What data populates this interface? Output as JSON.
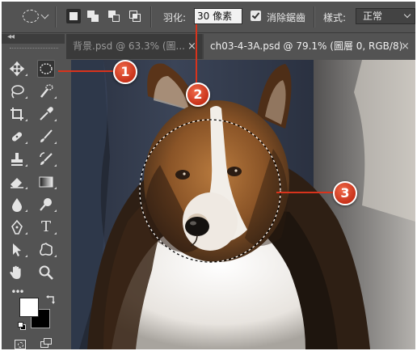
{
  "options_bar": {
    "feather_label": "羽化:",
    "feather_value": "30 像素",
    "antialias_label": "消除鋸齒",
    "antialias_checked": true,
    "style_label": "樣式:",
    "style_value": "正常"
  },
  "tabs": [
    {
      "label": "背景.psd @ 63.3% (圖...",
      "close": "×",
      "active": false
    },
    {
      "label": "ch03-4-3A.psd @ 79.1% (圖層 0, RGB/8)",
      "close": "×",
      "active": true
    }
  ],
  "tools_panel": {
    "collapse_glyph": "◂◂",
    "tools": [
      "move-icon",
      "elliptical-marquee-icon",
      "lasso-icon",
      "quick-selection-icon",
      "crop-icon",
      "eyedropper-icon",
      "spot-healing-icon",
      "brush-icon",
      "clone-stamp-icon",
      "history-brush-icon",
      "eraser-icon",
      "gradient-icon",
      "blur-icon",
      "dodge-icon",
      "pen-icon",
      "type-icon",
      "path-selection-icon",
      "custom-shape-icon",
      "hand-icon",
      "zoom-icon",
      "more-tools-icon"
    ],
    "type_tool_glyph": "T",
    "more_glyph": "•••",
    "foreground_color": "#ffffff",
    "background_color": "#000000"
  },
  "callouts": [
    "1",
    "2",
    "3"
  ],
  "colors": {
    "ui_dark": "#535353",
    "callout": "#d8331c"
  }
}
